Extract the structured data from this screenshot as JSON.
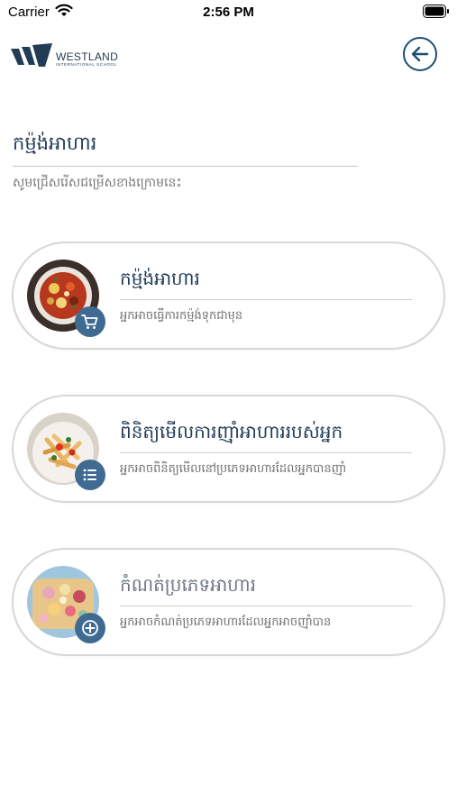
{
  "status_bar": {
    "carrier": "Carrier",
    "time": "2:56 PM"
  },
  "header": {
    "logo_name": "WESTLAND",
    "logo_subtitle": "INTERNATIONAL SCHOOL"
  },
  "page": {
    "title": "កម្ម៉ង់អាហារ",
    "subtitle": "សូមជ្រើសរើសជម្រើសខាងក្រោមនេះ"
  },
  "cards": [
    {
      "title": "កម្ម៉ង់អាហារ",
      "description": "អ្នកអាចធ្វើការកម្ម៉ង់ទុកជាមុន",
      "badge_icon": "cart-icon"
    },
    {
      "title": "ពិនិត្យមើលការញ៉ាំអាហាររបស់អ្នក",
      "description": "អ្នកអាចពិនិត្យមើលនៅប្រភេទអាហារដែលអ្នកបានញ៉ាំ",
      "badge_icon": "list-icon"
    },
    {
      "title": "កំណត់ប្រភេទអាហារ",
      "description": "អ្នកអាចកំណត់ប្រភេទអាហារដែលអ្នកអាចញ៉ាំបាន",
      "badge_icon": "plus-circle-icon"
    }
  ],
  "colors": {
    "accent": "#1b4f72",
    "badge": "#3f6b93",
    "text": "#1f3b57"
  }
}
